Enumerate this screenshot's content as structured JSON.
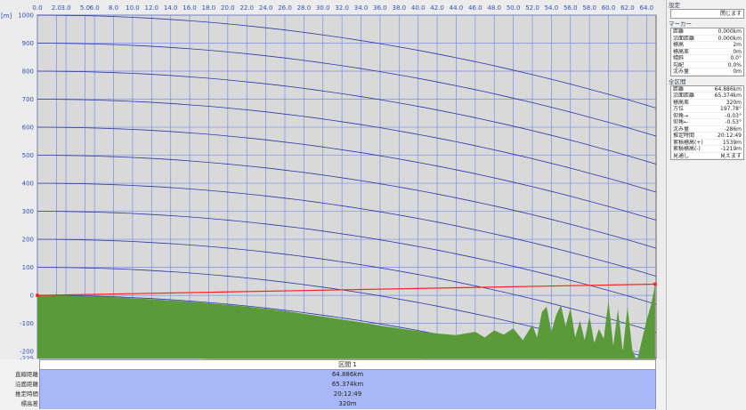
{
  "chart_data": {
    "type": "area",
    "title": "",
    "xlabel": "",
    "ylabel": "[m]",
    "xlim": [
      0,
      65
    ],
    "ylim": [
      -225,
      1000
    ],
    "x_ticks": [
      "0.0",
      "2.0",
      "3.0",
      "5.0",
      "6.0",
      "8.0",
      "10.0",
      "12.0",
      "14.0",
      "16.0",
      "18.0",
      "20.0",
      "22.0",
      "24.0",
      "26.0",
      "28.0",
      "30.0",
      "32.0",
      "34.0",
      "36.0",
      "38.0",
      "40.0",
      "42.0",
      "44.0",
      "46.0",
      "48.0",
      "50.0",
      "52.0",
      "54.0",
      "56.0",
      "58.0",
      "60.0",
      "62.0",
      "64.0"
    ],
    "x_tick_values": [
      0,
      2,
      3,
      5,
      6,
      8,
      10,
      12,
      14,
      16,
      18,
      20,
      22,
      24,
      26,
      28,
      30,
      32,
      34,
      36,
      38,
      40,
      42,
      44,
      46,
      48,
      50,
      52,
      54,
      56,
      58,
      60,
      62,
      64
    ],
    "y_ticks": [
      "1000",
      "900",
      "800",
      "700",
      "600",
      "500",
      "400",
      "300",
      "200",
      "100",
      "0",
      "-100",
      "-200",
      "-225"
    ],
    "y_tick_values": [
      1000,
      900,
      800,
      700,
      600,
      500,
      400,
      300,
      200,
      100,
      0,
      -100,
      -200,
      -225
    ],
    "grid": true,
    "curvature_lines": [
      1000,
      900,
      800,
      700,
      600,
      500,
      400,
      300,
      200,
      100,
      0,
      -100,
      -200
    ],
    "terrain_profile": {
      "x": [
        0,
        1,
        2,
        3,
        4,
        5,
        6,
        8,
        10,
        12,
        14,
        16,
        18,
        20,
        22,
        24,
        26,
        28,
        30,
        32,
        34,
        36,
        38,
        40,
        42,
        44,
        46,
        47,
        48,
        49,
        50,
        51,
        52,
        52.5,
        53,
        53.5,
        54,
        54.5,
        55,
        55.5,
        56,
        56.5,
        57,
        57.5,
        58,
        58.5,
        59,
        59.5,
        60,
        60.5,
        61,
        61.5,
        62,
        62.5,
        63,
        63.5,
        64,
        64.5,
        64.9
      ],
      "y": [
        0,
        0,
        0,
        0,
        -2,
        -2,
        -4,
        -6,
        -10,
        -14,
        -18,
        -22,
        -28,
        -34,
        -40,
        -48,
        -56,
        -66,
        -76,
        -86,
        -96,
        -108,
        -118,
        -128,
        -136,
        -142,
        -130,
        -150,
        -125,
        -140,
        -118,
        -160,
        -105,
        -150,
        -60,
        -40,
        -130,
        -70,
        -35,
        -110,
        -45,
        -150,
        -90,
        -160,
        -75,
        -170,
        -120,
        -155,
        -20,
        -180,
        -50,
        -200,
        -40,
        -195,
        -235,
        -160,
        -90,
        -30,
        40
      ]
    },
    "line_of_sight": {
      "x": [
        0,
        64.9
      ],
      "y": [
        0,
        40
      ]
    },
    "colors": {
      "plot_bg": "#d9d9d9",
      "grid": "#7a8ee6",
      "terrain": "#5a9a3a",
      "sight_line": "#ff2020",
      "curve": "#2a3aa8",
      "tick_text": "#3050c0"
    }
  },
  "section": {
    "header": "区間 1",
    "rows": [
      {
        "label": "直線距離",
        "value": "64.886km"
      },
      {
        "label": "沿面距離",
        "value": "65.374km"
      },
      {
        "label": "推定時間",
        "value": "20:12:49"
      },
      {
        "label": "標高差",
        "value": "320m"
      }
    ]
  },
  "panel": {
    "settings_title": "設定",
    "settings_button": "閉じます",
    "marker_title": "マーカー",
    "marker_rows": [
      {
        "label": "距離",
        "value": "0.000km"
      },
      {
        "label": "沿面距離",
        "value": "0.000km"
      },
      {
        "label": "標高",
        "value": "2m"
      },
      {
        "label": "標高差",
        "value": "0m"
      },
      {
        "label": "傾斜",
        "value": "0.0°"
      },
      {
        "label": "勾配",
        "value": "0.0%"
      },
      {
        "label": "沈み量",
        "value": "0m"
      }
    ],
    "all_title": "全区間",
    "all_rows": [
      {
        "label": "距離",
        "value": "64.886km"
      },
      {
        "label": "沿面距離",
        "value": "65.374km"
      },
      {
        "label": "標高差",
        "value": "320m"
      },
      {
        "label": "方位",
        "value": "197.78°"
      },
      {
        "label": "仰角→",
        "value": "-0.03°"
      },
      {
        "label": "仰角←",
        "value": "-0.53°"
      },
      {
        "label": "沈み量",
        "value": "-286m"
      },
      {
        "label": "推定時間",
        "value": "20:12:49"
      },
      {
        "label": "累積標高(+)",
        "value": "1539m"
      },
      {
        "label": "累積標高(-)",
        "value": "-1219m"
      },
      {
        "label": "見通し",
        "value": "見えます"
      }
    ]
  }
}
